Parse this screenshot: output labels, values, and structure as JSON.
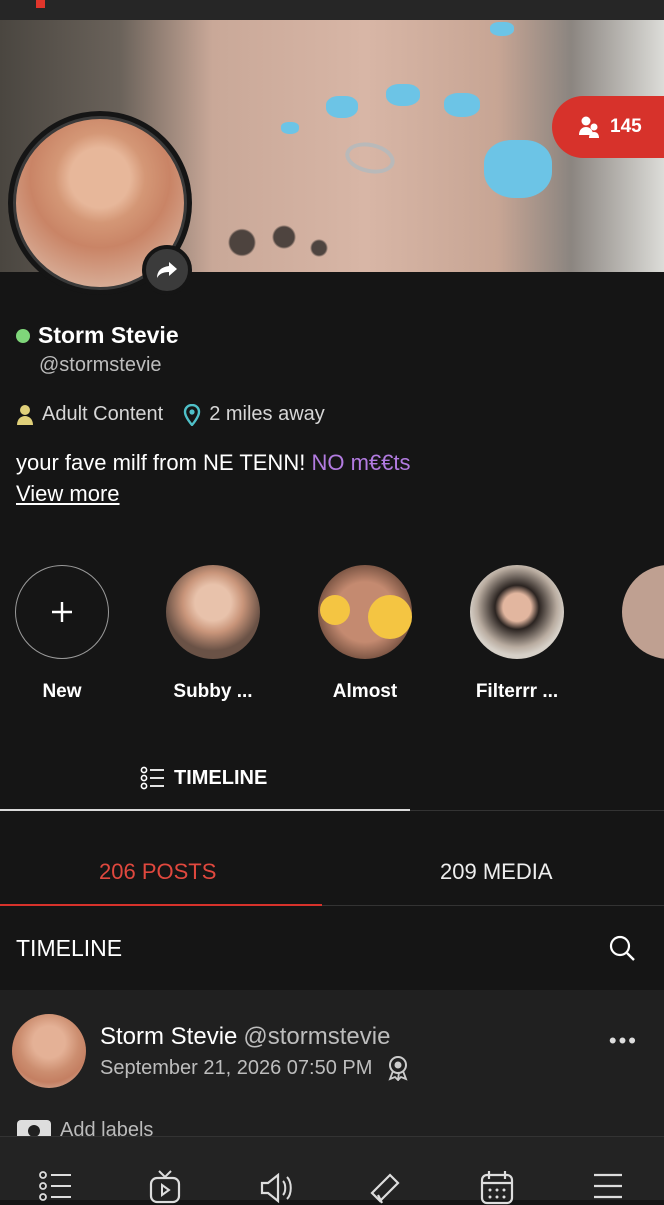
{
  "profile": {
    "name": "Storm Stevie",
    "handle": "@stormstevie",
    "likes_count": "145",
    "category": "Adult Content",
    "distance": "2 miles away",
    "bio_main": "your fave milf from NE TENN!",
    "bio_highlight": "NO m€€ts",
    "view_more": "View more"
  },
  "colors": {
    "accent": "#d7322b",
    "online": "#7fd67a",
    "highlight": "#b27be0"
  },
  "stories": [
    {
      "label": "New"
    },
    {
      "label": "Subby ..."
    },
    {
      "label": "Almost"
    },
    {
      "label": "Filterrr ..."
    }
  ],
  "tabs": {
    "timeline": "TIMELINE",
    "posts": "206 POSTS",
    "media": "209 MEDIA"
  },
  "timeline_header": {
    "title": "TIMELINE"
  },
  "post": {
    "author": "Storm Stevie",
    "handle": "@stormstevie",
    "date": "September 21, 2026 07:50 PM",
    "add_labels": "Add labels"
  },
  "bottom_nav": [
    "list-icon",
    "video-icon",
    "speaker-icon",
    "megaphone-icon",
    "calendar-icon",
    "menu-icon"
  ]
}
